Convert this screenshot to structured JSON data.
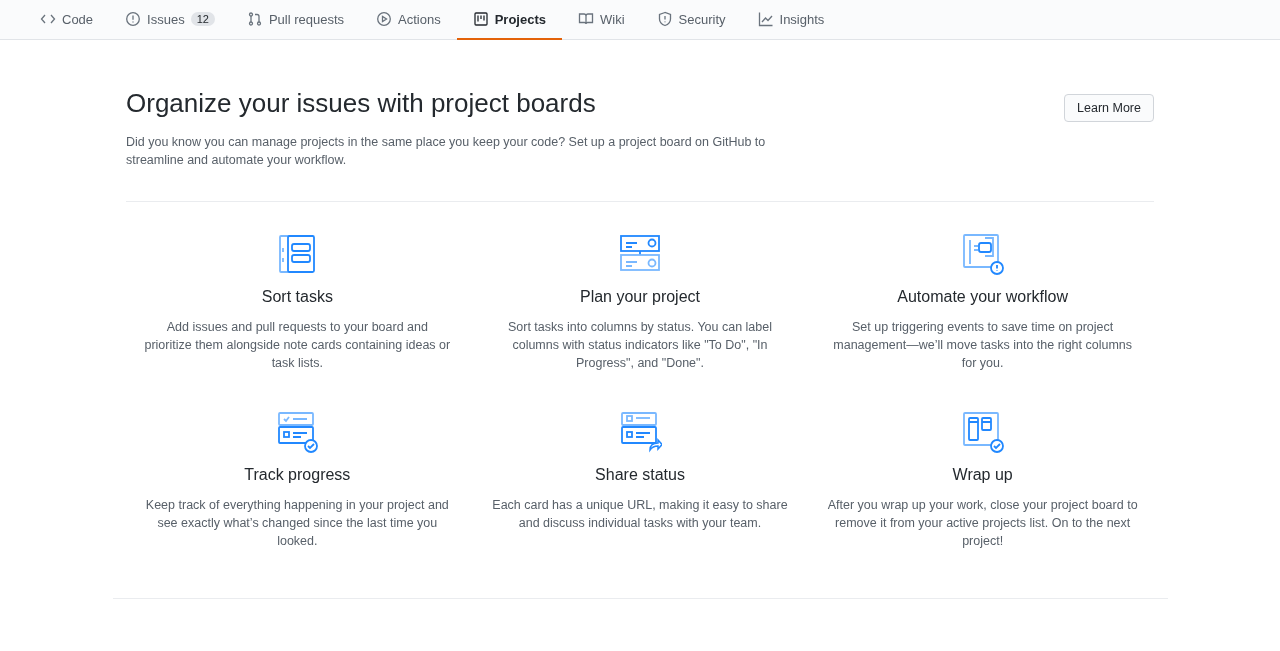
{
  "tabs": [
    {
      "label": "Code",
      "kind": "code",
      "selected": false
    },
    {
      "label": "Issues",
      "kind": "issue",
      "counter": "12",
      "selected": false
    },
    {
      "label": "Pull requests",
      "kind": "pull",
      "selected": false
    },
    {
      "label": "Actions",
      "kind": "play",
      "selected": false
    },
    {
      "label": "Projects",
      "kind": "project",
      "selected": true
    },
    {
      "label": "Wiki",
      "kind": "book",
      "selected": false
    },
    {
      "label": "Security",
      "kind": "shield",
      "selected": false
    },
    {
      "label": "Insights",
      "kind": "graph",
      "selected": false
    }
  ],
  "header": {
    "title": "Organize your issues with project boards",
    "description": "Did you know you can manage projects in the same place you keep your code? Set up a project board on GitHub to streamline and automate your workflow.",
    "button": "Learn More"
  },
  "features": [
    {
      "kind": "sort",
      "title": "Sort tasks",
      "text": "Add issues and pull requests to your board and prioritize them alongside note cards containing ideas or task lists."
    },
    {
      "kind": "plan",
      "title": "Plan your project",
      "text": "Sort tasks into columns by status. You can label columns with status indicators like \"To Do\", \"In Progress\", and \"Done\"."
    },
    {
      "kind": "automate",
      "title": "Automate your workflow",
      "text": "Set up triggering events to save time on project management—we’ll move tasks into the right columns for you."
    },
    {
      "kind": "track",
      "title": "Track progress",
      "text": "Keep track of everything happening in your project and see exactly what’s changed since the last time you looked."
    },
    {
      "kind": "share",
      "title": "Share status",
      "text": "Each card has a unique URL, making it easy to share and discuss individual tasks with your team."
    },
    {
      "kind": "wrap",
      "title": "Wrap up",
      "text": "After you wrap up your work, close your project board to remove it from your active projects list. On to the next project!"
    }
  ]
}
